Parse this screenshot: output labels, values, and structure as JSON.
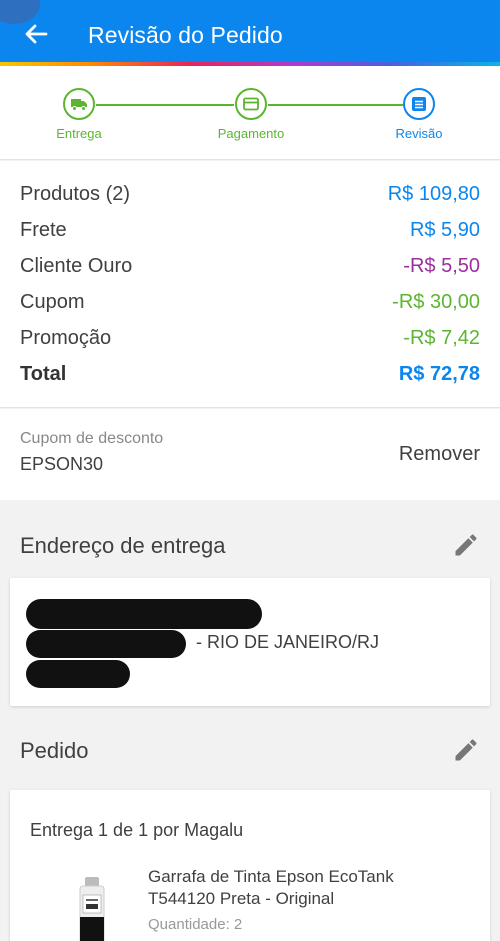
{
  "header": {
    "title": "Revisão do Pedido",
    "color": "#0b86ee"
  },
  "stepper": {
    "steps": [
      {
        "label": "Entrega",
        "icon": "truck-icon",
        "state": "done"
      },
      {
        "label": "Pagamento",
        "icon": "card-icon",
        "state": "done"
      },
      {
        "label": "Revisão",
        "icon": "list-icon",
        "state": "current"
      }
    ]
  },
  "summary": {
    "rows": [
      {
        "label": "Produtos (2)",
        "value": "R$ 109,80",
        "color": "#0b86ee"
      },
      {
        "label": "Frete",
        "value": "R$ 5,90",
        "color": "#0b86ee"
      },
      {
        "label": "Cliente Ouro",
        "value": "-R$ 5,50",
        "color": "#9c2f9e"
      },
      {
        "label": "Cupom",
        "value": "-R$ 30,00",
        "color": "#5cb531"
      },
      {
        "label": "Promoção",
        "value": "-R$ 7,42",
        "color": "#5cb531"
      }
    ],
    "total_label": "Total",
    "total_value": "R$ 72,78"
  },
  "coupon": {
    "label": "Cupom de desconto",
    "code": "EPSON30",
    "remove_label": "Remover"
  },
  "address": {
    "section_title": "Endereço de entrega",
    "city_line": "- RIO DE JANEIRO/RJ"
  },
  "order": {
    "section_title": "Pedido",
    "delivery_label": "Entrega 1 de 1 por Magalu",
    "product_name": "Garrafa de Tinta Epson EcoTank T544120 Preta - Original",
    "quantity": "Quantidade:  2"
  }
}
